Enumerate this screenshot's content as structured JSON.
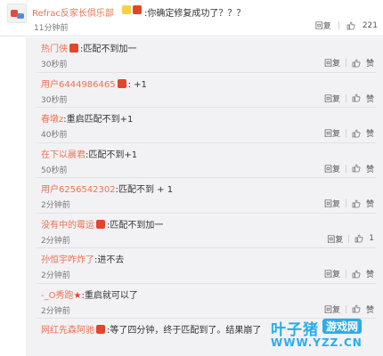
{
  "top_comment": {
    "username": "Refrac反家长俱乐部",
    "text": ":你确定修复成功了？？？",
    "time": "11分钟前",
    "reply_label": "回复",
    "like_count": "221"
  },
  "replies": [
    {
      "username": "热门侠",
      "text": ":匹配不到加一",
      "time": "30秒前",
      "reply_label": "回复",
      "like_label": "赞",
      "has_emblem": true
    },
    {
      "username": "用户6444986465",
      "text": ": +1",
      "time": "30秒前",
      "reply_label": "回复",
      "like_label": "赞",
      "has_emblem": true
    },
    {
      "username": "春墩z",
      "text": ":重启匹配不到+1",
      "time": "40秒前",
      "reply_label": "回复",
      "like_label": "赞",
      "has_emblem": false
    },
    {
      "username": "在下以晨君",
      "text": ":匹配不到+1",
      "time": "50秒前",
      "reply_label": "回复",
      "like_label": "赞",
      "has_emblem": false
    },
    {
      "username": "用户6256542302",
      "text": ":匹配不到 + 1",
      "time": "2分钟前",
      "reply_label": "回复",
      "like_label": "赞",
      "has_emblem": false
    },
    {
      "username": "没有中的霉运",
      "text": ":匹配不到加一",
      "time": "2分钟前",
      "reply_label": "回复",
      "like_label": "1",
      "has_emblem": true
    },
    {
      "username": "孙恒宇咋炸了",
      "text": ":进不去",
      "time": "2分钟前",
      "reply_label": "回复",
      "like_label": "赞",
      "has_emblem": false
    },
    {
      "username": "-_O秀跑",
      "text": ":重启就可以了",
      "time": "2分钟前",
      "reply_label": "回复",
      "like_label": "赞",
      "has_emblem": false,
      "has_star": true
    },
    {
      "username": "网红先森阿驰",
      "text": ":等了四分钟，终于匹配到了。结果崩了",
      "time": "",
      "reply_label": "回复",
      "like_label": "赞",
      "has_emblem": true
    }
  ],
  "watermark": {
    "title": "叶子猪",
    "game": "游戏网",
    "url": "WWW.YZZ.CN"
  }
}
